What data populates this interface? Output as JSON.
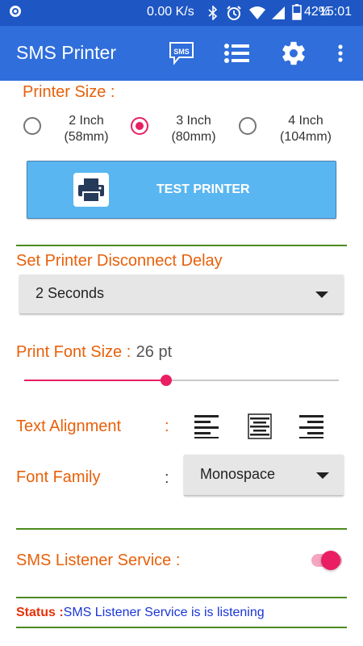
{
  "status_bar": {
    "network_speed": "0.00 K/s",
    "battery": "42%",
    "time": "15:01"
  },
  "app_bar": {
    "title": "SMS Printer",
    "sms_icon_label": "SMS",
    "icons": [
      "sms-icon",
      "list-icon",
      "gear-icon",
      "more-vert-icon"
    ]
  },
  "printer_size": {
    "label": "Printer Size :",
    "options": [
      {
        "line1": "2 Inch",
        "line2": "(58mm)",
        "selected": false
      },
      {
        "line1": "3 Inch",
        "line2": "(80mm)",
        "selected": true
      },
      {
        "line1": "4 Inch",
        "line2": "(104mm)",
        "selected": false
      }
    ]
  },
  "test_button": {
    "label": "TEST PRINTER"
  },
  "disconnect_delay": {
    "label": "Set Printer Disconnect Delay",
    "value": "2 Seconds"
  },
  "font_size": {
    "label": "Print Font Size :",
    "value": "26 pt",
    "slider_fraction": 0.45
  },
  "text_alignment": {
    "label": "Text Alignment",
    "colon": ":",
    "icons": [
      "align-left-icon",
      "align-center-icon",
      "align-right-icon"
    ]
  },
  "font_family": {
    "label": "Font Family",
    "colon": ":",
    "value": "Monospace"
  },
  "sms_listener": {
    "label": "SMS Listener Service :",
    "enabled": true
  },
  "status": {
    "label": "Status :",
    "text": "SMS Listener Service is is  listening"
  },
  "colors": {
    "status_bar": "#1E57C4",
    "app_bar": "#2F6EDB",
    "accent": "#E91E63",
    "label_orange": "#E8600A",
    "divider_green": "#4C8A1E",
    "button_blue": "#5AB6F0",
    "status_text_blue": "#1A35D6",
    "status_label_red": "#E8300A"
  }
}
